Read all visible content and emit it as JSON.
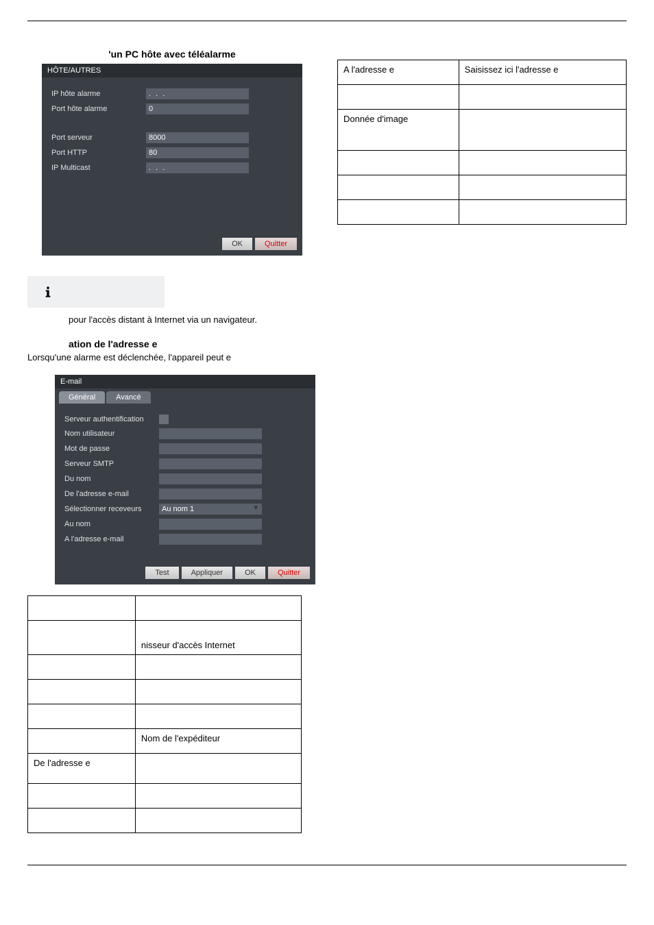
{
  "section1": {
    "title": "'un PC hôte avec téléalarme",
    "panel_header": "HÔTE/AUTRES",
    "fields": {
      "ip_hote": {
        "label": "IP hôte alarme",
        "value": ".   .   ."
      },
      "port_hote": {
        "label": "Port hôte alarme",
        "value": "0"
      },
      "port_serveur": {
        "label": "Port serveur",
        "value": "8000"
      },
      "port_http": {
        "label": "Port HTTP",
        "value": "80"
      },
      "ip_multicast": {
        "label": "IP Multicast",
        "value": ".   .   ."
      }
    },
    "buttons": {
      "ok": "OK",
      "quitter": "Quitter"
    }
  },
  "note": "pour l'accès distant à Internet via un navigateur.",
  "section2": {
    "title": "ation de l'adresse e",
    "body": "Lorsqu'une alarme est déclenchée, l'appareil peut e",
    "panel_header": "E-mail",
    "tabs": {
      "general": "Général",
      "avance": "Avancé"
    },
    "fields": {
      "auth": {
        "label": "Serveur authentification"
      },
      "user": {
        "label": "Nom utilisateur"
      },
      "pass": {
        "label": "Mot de passe"
      },
      "smtp": {
        "label": "Serveur SMTP"
      },
      "du_nom": {
        "label": "Du nom"
      },
      "de_mail": {
        "label": "De l'adresse e-mail"
      },
      "recv": {
        "label": "Sélectionner receveurs",
        "value": "Au nom 1"
      },
      "au_nom": {
        "label": "Au nom"
      },
      "a_mail": {
        "label": "A l'adresse e-mail"
      }
    },
    "buttons": {
      "test": "Test",
      "appliquer": "Appliquer",
      "ok": "OK",
      "quitter": "Quitter"
    }
  },
  "left_table": {
    "rows": [
      {
        "c1": "",
        "c2": ""
      },
      {
        "c1": "",
        "c2": "nisseur d'accès Internet"
      },
      {
        "c1": "",
        "c2": ""
      },
      {
        "c1": "",
        "c2": ""
      },
      {
        "c1": "",
        "c2": ""
      },
      {
        "c1": "",
        "c2": "Nom de l'expéditeur"
      },
      {
        "c1": "De l'adresse e",
        "c2": ""
      },
      {
        "c1": "",
        "c2": ""
      },
      {
        "c1": "",
        "c2": ""
      }
    ]
  },
  "right_table": {
    "rows": [
      {
        "c1": "A l'adresse e",
        "c2": "Saisissez ici l'adresse e"
      },
      {
        "c1": "",
        "c2": ""
      },
      {
        "c1": "Donnée d'image",
        "c2": ""
      },
      {
        "c1": "",
        "c2": ""
      },
      {
        "c1": "",
        "c2": ""
      },
      {
        "c1": "",
        "c2": ""
      }
    ]
  }
}
